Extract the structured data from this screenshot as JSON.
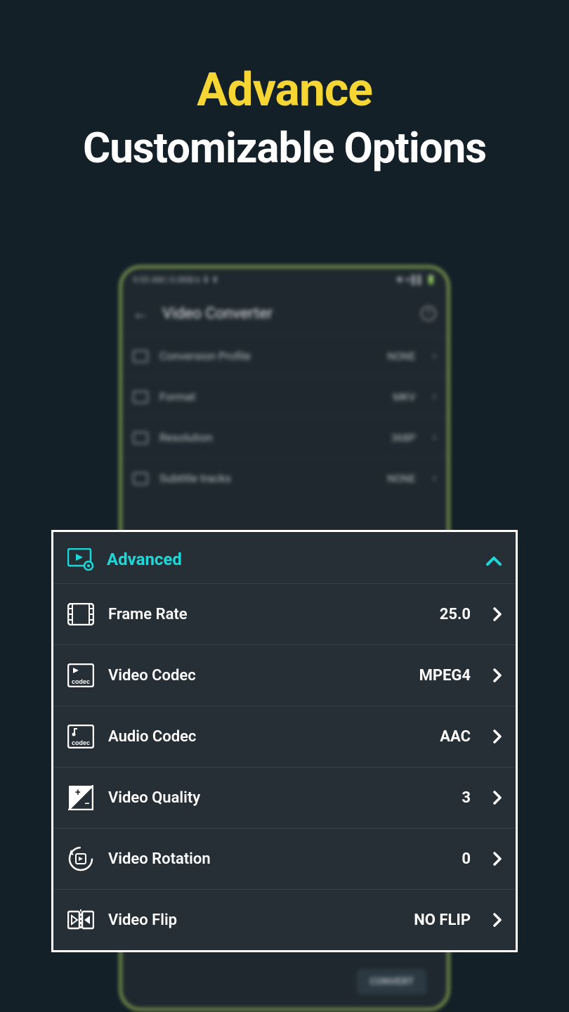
{
  "hero": {
    "title": "Advance",
    "subtitle": "Customizable Options"
  },
  "statusbar": {
    "left": "9:55 AM | 0.0KB/s ⬇ ⬆",
    "right": "✱ ▾ ▌▌ 🔋"
  },
  "app": {
    "title": "Video Converter",
    "convert": "CONVERT"
  },
  "bg_rows": [
    {
      "label": "Conversion Profile",
      "value": "NONE"
    },
    {
      "label": "Format",
      "value": "MKV"
    },
    {
      "label": "Resolution",
      "value": "368P"
    },
    {
      "label": "Subtitle tracks",
      "value": "NONE"
    }
  ],
  "panel": {
    "header": "Advanced",
    "rows": [
      {
        "icon": "film",
        "label": "Frame Rate",
        "value": "25.0"
      },
      {
        "icon": "video-codec",
        "label": "Video Codec",
        "value": "MPEG4"
      },
      {
        "icon": "audio-codec",
        "label": "Audio Codec",
        "value": "AAC"
      },
      {
        "icon": "quality",
        "label": "Video Quality",
        "value": "3"
      },
      {
        "icon": "rotation",
        "label": "Video Rotation",
        "value": "0"
      },
      {
        "icon": "flip",
        "label": "Video Flip",
        "value": "NO FLIP"
      }
    ]
  }
}
